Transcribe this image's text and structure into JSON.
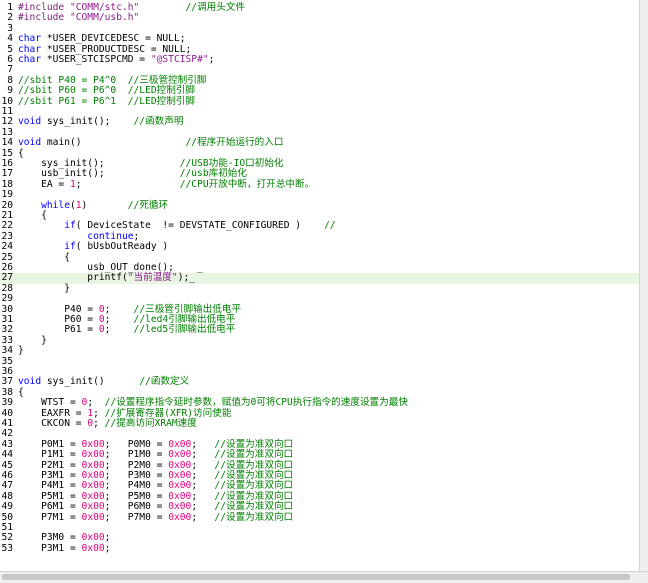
{
  "editor": {
    "lines": [
      {
        "n": "1",
        "parts": [
          [
            "pp",
            "#include "
          ],
          [
            "str",
            "\"COMM/stc.h\""
          ],
          [
            "plain",
            "        "
          ],
          [
            "cmt",
            "//调用头文件"
          ]
        ]
      },
      {
        "n": "2",
        "parts": [
          [
            "pp",
            "#include "
          ],
          [
            "str",
            "\"COMM/usb.h\""
          ]
        ]
      },
      {
        "n": "3",
        "parts": []
      },
      {
        "n": "4",
        "parts": [
          [
            "kw",
            "char "
          ],
          [
            "plain",
            "*USER_DEVICEDESC = NULL;"
          ]
        ]
      },
      {
        "n": "5",
        "parts": [
          [
            "kw",
            "char "
          ],
          [
            "plain",
            "*USER_PRODUCTDESC = NULL;"
          ]
        ]
      },
      {
        "n": "6",
        "parts": [
          [
            "kw",
            "char "
          ],
          [
            "plain",
            "*USER_STCISPCMD = "
          ],
          [
            "str",
            "\"@STCISP#\""
          ],
          [
            "plain",
            ";"
          ]
        ]
      },
      {
        "n": "7",
        "parts": []
      },
      {
        "n": "8",
        "parts": [
          [
            "cmt",
            "//sbit P40 = P4^0  //三极管控制引脚"
          ]
        ]
      },
      {
        "n": "9",
        "parts": [
          [
            "cmt",
            "//sbit P60 = P6^0  //LED控制引脚"
          ]
        ]
      },
      {
        "n": "10",
        "parts": [
          [
            "cmt",
            "//sbit P61 = P6^1  //LED控制引脚"
          ]
        ]
      },
      {
        "n": "11",
        "parts": []
      },
      {
        "n": "12",
        "parts": [
          [
            "kw",
            "void "
          ],
          [
            "plain",
            "sys_init();    "
          ],
          [
            "cmt",
            "//函数声明"
          ]
        ]
      },
      {
        "n": "13",
        "parts": []
      },
      {
        "n": "14",
        "parts": [
          [
            "kw",
            "void "
          ],
          [
            "plain",
            "main()                  "
          ],
          [
            "cmt",
            "//程序开始运行的入口"
          ]
        ]
      },
      {
        "n": "15",
        "parts": [
          [
            "plain",
            "{"
          ]
        ]
      },
      {
        "n": "16",
        "parts": [
          [
            "plain",
            "    sys_init();             "
          ],
          [
            "cmt",
            "//USB功能-IO口初始化"
          ]
        ]
      },
      {
        "n": "17",
        "parts": [
          [
            "plain",
            "    usb_init();             "
          ],
          [
            "cmt",
            "//usb库初始化"
          ]
        ]
      },
      {
        "n": "18",
        "parts": [
          [
            "plain",
            "    EA = "
          ],
          [
            "num",
            "1"
          ],
          [
            "plain",
            ";                 "
          ],
          [
            "cmt",
            "//CPU开放中断，打开总中断。"
          ]
        ]
      },
      {
        "n": "19",
        "parts": []
      },
      {
        "n": "20",
        "parts": [
          [
            "kw",
            "    while"
          ],
          [
            "plain",
            "("
          ],
          [
            "num",
            "1"
          ],
          [
            "plain",
            ")       "
          ],
          [
            "cmt",
            "//死循环"
          ]
        ]
      },
      {
        "n": "21",
        "parts": [
          [
            "plain",
            "    {"
          ]
        ]
      },
      {
        "n": "22",
        "parts": [
          [
            "kw",
            "        if"
          ],
          [
            "plain",
            "( DeviceState  != DEVSTATE_CONFIGURED )    "
          ],
          [
            "cmt",
            "//"
          ]
        ]
      },
      {
        "n": "23",
        "parts": [
          [
            "kw",
            "            continue"
          ],
          [
            "plain",
            ";"
          ]
        ]
      },
      {
        "n": "24",
        "parts": [
          [
            "kw",
            "        if"
          ],
          [
            "plain",
            "( bUsbOutReady )"
          ]
        ]
      },
      {
        "n": "25",
        "parts": [
          [
            "plain",
            "        {"
          ]
        ]
      },
      {
        "n": "26",
        "parts": [
          [
            "plain",
            "            usb_OUT_done();    _"
          ]
        ]
      },
      {
        "n": "27",
        "parts": [
          [
            "plain",
            "            printf("
          ],
          [
            "str",
            "\"当前温度\""
          ],
          [
            "plain",
            ");_"
          ]
        ]
      },
      {
        "n": "28",
        "parts": [
          [
            "plain",
            "        }"
          ]
        ]
      },
      {
        "n": "29",
        "parts": []
      },
      {
        "n": "30",
        "parts": [
          [
            "plain",
            "        P40 = "
          ],
          [
            "num",
            "0"
          ],
          [
            "plain",
            ";    "
          ],
          [
            "cmt",
            "//三极管引脚输出低电平"
          ]
        ]
      },
      {
        "n": "31",
        "parts": [
          [
            "plain",
            "        P60 = "
          ],
          [
            "num",
            "0"
          ],
          [
            "plain",
            ";    "
          ],
          [
            "cmt",
            "//led4引脚输出低电平"
          ]
        ]
      },
      {
        "n": "32",
        "parts": [
          [
            "plain",
            "        P61 = "
          ],
          [
            "num",
            "0"
          ],
          [
            "plain",
            ";    "
          ],
          [
            "cmt",
            "//led5引脚输出低电平"
          ]
        ]
      },
      {
        "n": "33",
        "parts": [
          [
            "plain",
            "    }"
          ]
        ]
      },
      {
        "n": "34",
        "parts": [
          [
            "plain",
            "}"
          ]
        ]
      },
      {
        "n": "35",
        "parts": []
      },
      {
        "n": "36",
        "parts": []
      },
      {
        "n": "37",
        "parts": [
          [
            "kw",
            "void "
          ],
          [
            "plain",
            "sys_init()      "
          ],
          [
            "cmt",
            "//函数定义"
          ]
        ]
      },
      {
        "n": "38",
        "parts": [
          [
            "plain",
            "{"
          ]
        ]
      },
      {
        "n": "39",
        "parts": [
          [
            "plain",
            "    WTST = "
          ],
          [
            "num",
            "0"
          ],
          [
            "plain",
            ";  "
          ],
          [
            "cmt",
            "//设置程序指令延时参数，赋值为0可将CPU执行指令的速度设置为最快"
          ]
        ]
      },
      {
        "n": "40",
        "parts": [
          [
            "plain",
            "    EAXFR = "
          ],
          [
            "num",
            "1"
          ],
          [
            "plain",
            "; "
          ],
          [
            "cmt",
            "//扩展寄存器(XFR)访问使能"
          ]
        ]
      },
      {
        "n": "41",
        "parts": [
          [
            "plain",
            "    CKCON = "
          ],
          [
            "num",
            "0"
          ],
          [
            "plain",
            "; "
          ],
          [
            "cmt",
            "//提高访问XRAM速度"
          ]
        ]
      },
      {
        "n": "42",
        "parts": []
      },
      {
        "n": "43",
        "parts": [
          [
            "plain",
            "    P0M1 = "
          ],
          [
            "num",
            "0x00"
          ],
          [
            "plain",
            ";   P0M0 = "
          ],
          [
            "num",
            "0x00"
          ],
          [
            "plain",
            ";   "
          ],
          [
            "cmt",
            "//设置为准双向口"
          ]
        ]
      },
      {
        "n": "44",
        "parts": [
          [
            "plain",
            "    P1M1 = "
          ],
          [
            "num",
            "0x00"
          ],
          [
            "plain",
            ";   P1M0 = "
          ],
          [
            "num",
            "0x00"
          ],
          [
            "plain",
            ";   "
          ],
          [
            "cmt",
            "//设置为准双向口"
          ]
        ]
      },
      {
        "n": "45",
        "parts": [
          [
            "plain",
            "    P2M1 = "
          ],
          [
            "num",
            "0x00"
          ],
          [
            "plain",
            ";   P2M0 = "
          ],
          [
            "num",
            "0x00"
          ],
          [
            "plain",
            ";   "
          ],
          [
            "cmt",
            "//设置为准双向口"
          ]
        ]
      },
      {
        "n": "46",
        "parts": [
          [
            "plain",
            "    P3M1 = "
          ],
          [
            "num",
            "0x00"
          ],
          [
            "plain",
            ";   P3M0 = "
          ],
          [
            "num",
            "0x00"
          ],
          [
            "plain",
            ";   "
          ],
          [
            "cmt",
            "//设置为准双向口"
          ]
        ]
      },
      {
        "n": "47",
        "parts": [
          [
            "plain",
            "    P4M1 = "
          ],
          [
            "num",
            "0x00"
          ],
          [
            "plain",
            ";   P4M0 = "
          ],
          [
            "num",
            "0x00"
          ],
          [
            "plain",
            ";   "
          ],
          [
            "cmt",
            "//设置为准双向口"
          ]
        ]
      },
      {
        "n": "48",
        "parts": [
          [
            "plain",
            "    P5M1 = "
          ],
          [
            "num",
            "0x00"
          ],
          [
            "plain",
            ";   P5M0 = "
          ],
          [
            "num",
            "0x00"
          ],
          [
            "plain",
            ";   "
          ],
          [
            "cmt",
            "//设置为准双向口"
          ]
        ]
      },
      {
        "n": "49",
        "parts": [
          [
            "plain",
            "    P6M1 = "
          ],
          [
            "num",
            "0x00"
          ],
          [
            "plain",
            ";   P6M0 = "
          ],
          [
            "num",
            "0x00"
          ],
          [
            "plain",
            ";   "
          ],
          [
            "cmt",
            "//设置为准双向口"
          ]
        ]
      },
      {
        "n": "50",
        "parts": [
          [
            "plain",
            "    P7M1 = "
          ],
          [
            "num",
            "0x00"
          ],
          [
            "plain",
            ";   P7M0 = "
          ],
          [
            "num",
            "0x00"
          ],
          [
            "plain",
            ";   "
          ],
          [
            "cmt",
            "//设置为准双向口"
          ]
        ]
      },
      {
        "n": "51",
        "parts": []
      },
      {
        "n": "52",
        "parts": [
          [
            "plain",
            "    P3M0 = "
          ],
          [
            "num",
            "0x00"
          ],
          [
            "plain",
            ";"
          ]
        ]
      },
      {
        "n": "53",
        "parts": [
          [
            "plain",
            "    P3M1 = "
          ],
          [
            "num",
            "0x00"
          ],
          [
            "plain",
            ";"
          ]
        ]
      }
    ],
    "current_line": "27"
  },
  "colors": {
    "keyword": "#0000ff",
    "string": "#8b1c8b",
    "comment": "#008000",
    "number": "#e6007a",
    "current_line_bg": "#e8f5e1"
  }
}
